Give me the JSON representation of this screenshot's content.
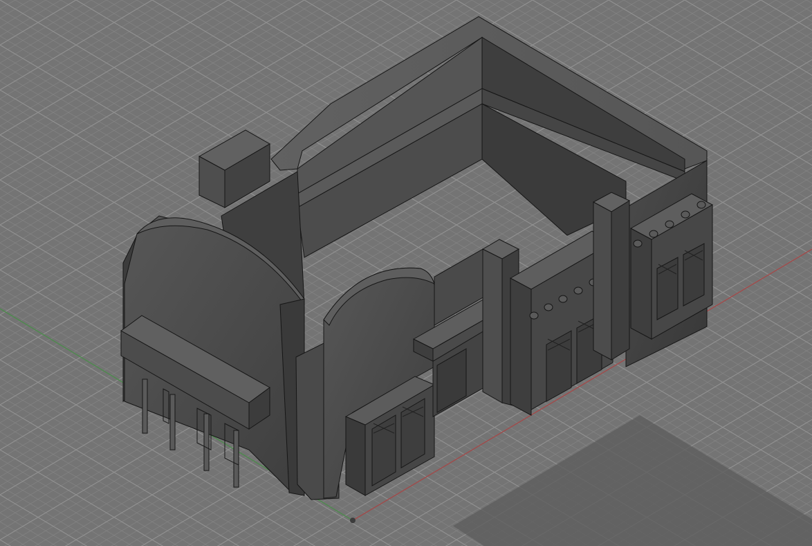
{
  "viewport": {
    "view_mode": "isometric",
    "model": "building",
    "grid_visible": true,
    "colors": {
      "background": "#747474",
      "grid_minor": "#808080",
      "grid_major": "#8f8f8f",
      "x_axis": "#a04a4a",
      "y_axis": "#4e8a4e",
      "model_base": "#4a4a4a",
      "model_edge": "#161616"
    }
  }
}
